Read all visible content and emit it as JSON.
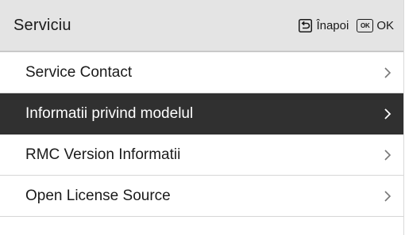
{
  "header": {
    "title": "Serviciu",
    "back_label": "Înapoi",
    "ok_icon_text": "OK",
    "ok_label": "OK",
    "back_icon": "back-arrow-icon"
  },
  "menu": {
    "selected_index": 1,
    "items": [
      {
        "label": "Service Contact",
        "icon": "chevron-right-icon"
      },
      {
        "label": "Informatii privind modelul",
        "icon": "chevron-right-icon"
      },
      {
        "label": "RMC Version Informatii",
        "icon": "chevron-right-icon"
      },
      {
        "label": "Open License Source",
        "icon": "chevron-right-icon"
      }
    ]
  },
  "colors": {
    "header_bg": "#e4e4e4",
    "selected_bg": "#303030",
    "text": "#1a1a1a"
  }
}
